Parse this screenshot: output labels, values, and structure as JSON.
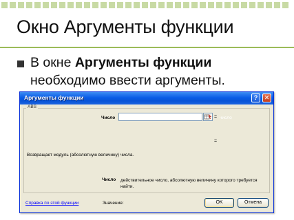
{
  "colors": {
    "accent": "#9bbb59",
    "xp_titlebar": "#0a5ce6",
    "dialog_bg": "#ece9d8",
    "link": "#0000ff"
  },
  "slide": {
    "title": "Окно Аргументы функции",
    "bullet_prefix": "В окне ",
    "bullet_bold": "Аргументы функции",
    "bullet_suffix": " необходимо ввести аргументы."
  },
  "dialog": {
    "title": "Аргументы функции",
    "help_glyph": "?",
    "close_glyph": "✕",
    "function_name": "ABS",
    "arg_label": "Число",
    "arg_value": "",
    "arg_equals": "=",
    "arg_hint": "число",
    "result_equals": "=",
    "function_description": "Возвращает модуль (абсолютную величину) числа.",
    "detail_label": "Число",
    "detail_text": "действительное число, абсолютную величину которого требуется найти.",
    "help_link": "Справка по этой функции",
    "value_label": "Значение:",
    "ok_label": "OK",
    "cancel_label": "Отмена"
  }
}
